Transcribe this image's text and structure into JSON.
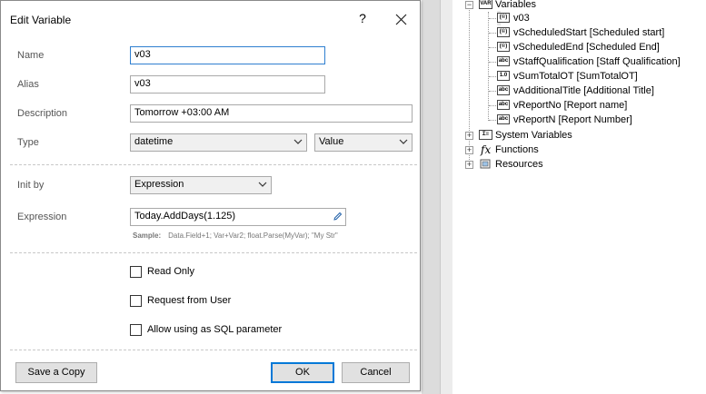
{
  "dialog": {
    "title": "Edit Variable",
    "help_label": "?",
    "fields": {
      "name_label": "Name",
      "name_value": "v03",
      "alias_label": "Alias",
      "alias_value": "v03",
      "description_label": "Description",
      "description_value": "Tomorrow +03:00 AM",
      "type_label": "Type",
      "type_value": "datetime",
      "type_mode_value": "Value",
      "init_by_label": "Init by",
      "init_by_value": "Expression",
      "expression_label": "Expression",
      "expression_value": "Today.AddDays(1.125)"
    },
    "sample": {
      "label": "Sample:",
      "text": "Data.Field+1; Var+Var2; float.Parse(MyVar); \"My Str\""
    },
    "checkboxes": {
      "read_only": {
        "label": "Read Only",
        "checked": false
      },
      "request_from_user": {
        "label": "Request from User",
        "checked": false
      },
      "allow_sql": {
        "label": "Allow using as SQL parameter",
        "checked": false
      }
    },
    "buttons": {
      "save_copy": "Save a Copy",
      "ok": "OK",
      "cancel": "Cancel"
    }
  },
  "tree": {
    "variables": {
      "label": "Variables",
      "icon": "variables-icon",
      "items": [
        {
          "label": "v03",
          "icon": "datetime-icon"
        },
        {
          "label": "vScheduledStart [Scheduled start]",
          "icon": "datetime-icon"
        },
        {
          "label": "vScheduledEnd [Scheduled End]",
          "icon": "datetime-icon"
        },
        {
          "label": "vStaffQualification [Staff Qualification]",
          "icon": "string-icon"
        },
        {
          "label": "vSumTotalOT [SumTotalOT]",
          "icon": "number-icon"
        },
        {
          "label": "vAdditionalTitle [Additional Title]",
          "icon": "string-icon"
        },
        {
          "label": "vReportNo [Report name]",
          "icon": "string-icon"
        },
        {
          "label": "vReportN [Report Number]",
          "icon": "string-icon"
        }
      ]
    },
    "system_variables": "System Variables",
    "functions": "Functions",
    "resources": "Resources"
  }
}
